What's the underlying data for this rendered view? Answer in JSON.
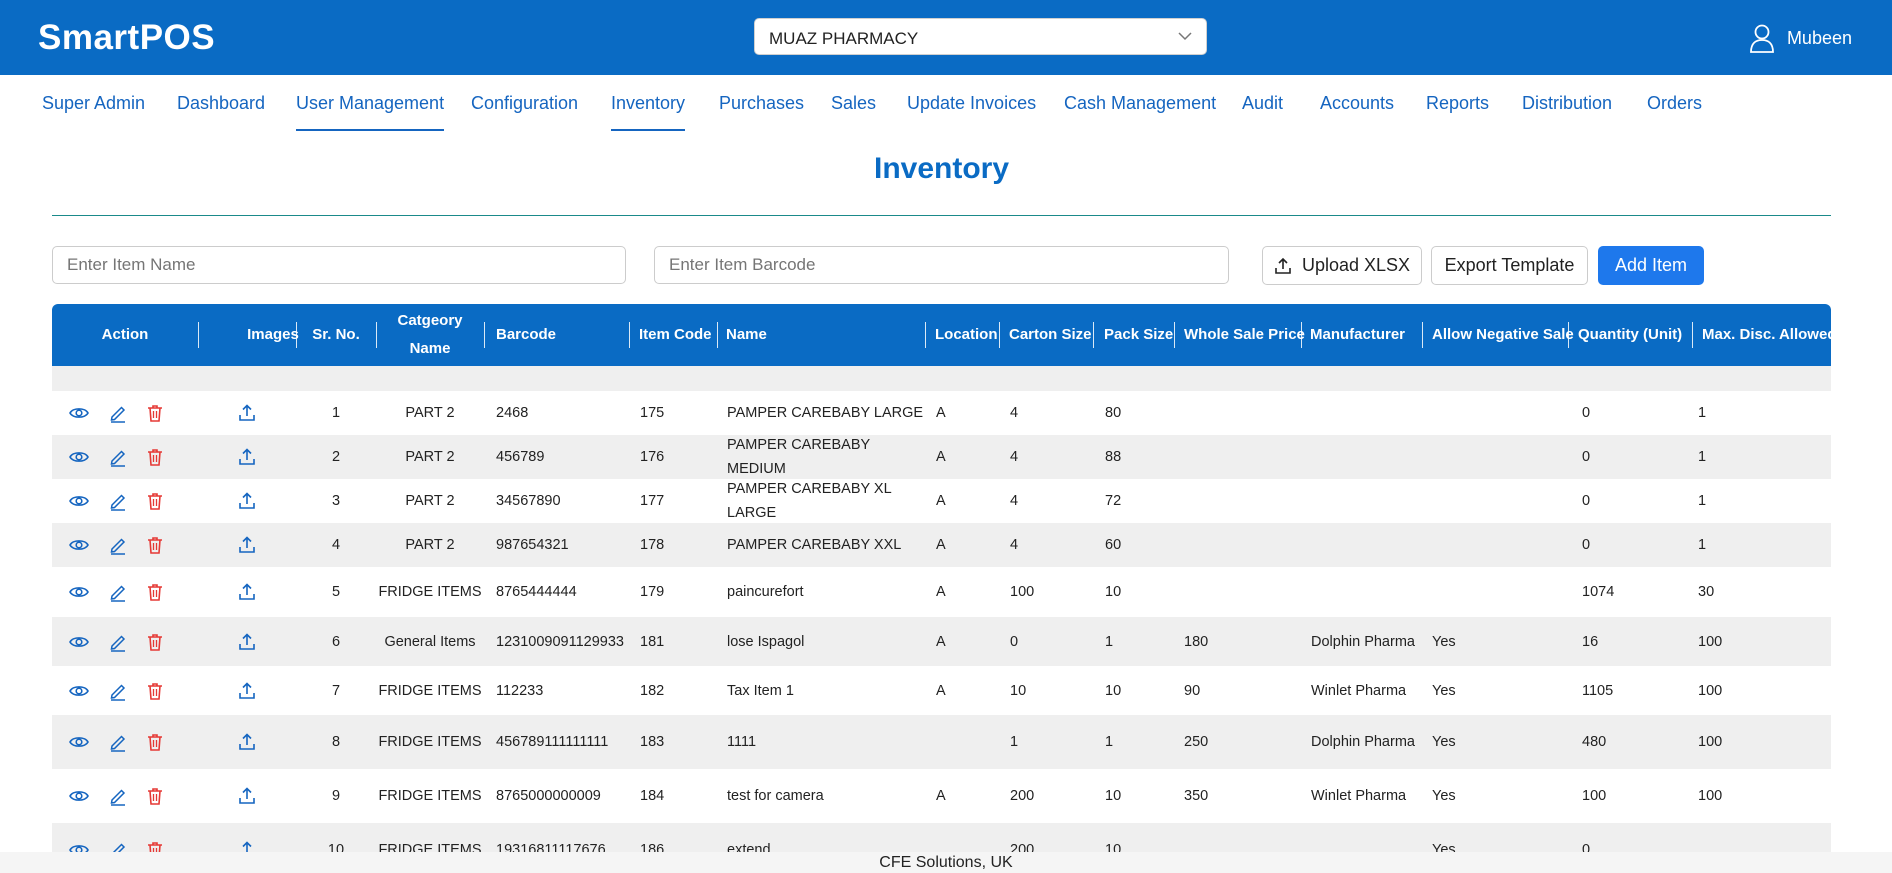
{
  "app": {
    "brand": "SmartPOS",
    "store": "MUAZ PHARMACY",
    "user": "Mubeen"
  },
  "nav": [
    {
      "label": "Super Admin",
      "active": false
    },
    {
      "label": "Dashboard",
      "active": false
    },
    {
      "label": "User Management",
      "active": true
    },
    {
      "label": "Configuration",
      "active": false
    },
    {
      "label": "Inventory",
      "active": true
    },
    {
      "label": "Purchases",
      "active": false
    },
    {
      "label": "Sales",
      "active": false
    },
    {
      "label": "Update Invoices",
      "active": false
    },
    {
      "label": "Cash Management",
      "active": false
    },
    {
      "label": "Audit",
      "active": false
    },
    {
      "label": "Accounts",
      "active": false
    },
    {
      "label": "Reports",
      "active": false
    },
    {
      "label": "Distribution",
      "active": false
    },
    {
      "label": "Orders",
      "active": false
    }
  ],
  "page": {
    "title": "Inventory"
  },
  "filters": {
    "item_name_placeholder": "Enter Item Name",
    "barcode_placeholder": "Enter Item Barcode"
  },
  "buttons": {
    "upload": "Upload XLSX",
    "export": "Export Template",
    "add": "Add Item"
  },
  "table": {
    "headers": {
      "action": "Action",
      "images": "Images",
      "sr": "Sr. No.",
      "category_line1": "Catgeory",
      "category_line2": "Name",
      "barcode": "Barcode",
      "item_code": "Item Code",
      "name": "Name",
      "location": "Location",
      "carton": "Carton Size",
      "pack": "Pack Size",
      "wholesale": "Whole Sale Price",
      "manufacturer": "Manufacturer",
      "allow_neg": "Allow Negative Sale",
      "qty": "Quantity (Unit)",
      "max_disc": "Max. Disc. Allowed"
    },
    "rows": [
      {
        "sr": "1",
        "category": "PART 2",
        "barcode": "2468",
        "code": "175",
        "name": "PAMPER CAREBABY LARGE",
        "location": "A",
        "carton": "4",
        "pack": "80",
        "wholesale": "",
        "manufacturer": "",
        "allow": "",
        "qty": "0",
        "disc": "1"
      },
      {
        "sr": "2",
        "category": "PART 2",
        "barcode": "456789",
        "code": "176",
        "name": "PAMPER CAREBABY MEDIUM",
        "location": "A",
        "carton": "4",
        "pack": "88",
        "wholesale": "",
        "manufacturer": "",
        "allow": "",
        "qty": "0",
        "disc": "1"
      },
      {
        "sr": "3",
        "category": "PART 2",
        "barcode": "34567890",
        "code": "177",
        "name": "PAMPER CAREBABY XL LARGE",
        "location": "A",
        "carton": "4",
        "pack": "72",
        "wholesale": "",
        "manufacturer": "",
        "allow": "",
        "qty": "0",
        "disc": "1"
      },
      {
        "sr": "4",
        "category": "PART 2",
        "barcode": "987654321",
        "code": "178",
        "name": "PAMPER CAREBABY XXL",
        "location": "A",
        "carton": "4",
        "pack": "60",
        "wholesale": "",
        "manufacturer": "",
        "allow": "",
        "qty": "0",
        "disc": "1"
      },
      {
        "sr": "5",
        "category": "FRIDGE ITEMS",
        "barcode": "8765444444",
        "code": "179",
        "name": "paincurefort",
        "location": "A",
        "carton": "100",
        "pack": "10",
        "wholesale": "",
        "manufacturer": "",
        "allow": "",
        "qty": "1074",
        "disc": "30"
      },
      {
        "sr": "6",
        "category": "General Items",
        "barcode": "1231009091129933",
        "code": "181",
        "name": "lose Ispagol",
        "location": "A",
        "carton": "0",
        "pack": "1",
        "wholesale": "180",
        "manufacturer": "Dolphin Pharma",
        "allow": "Yes",
        "qty": "16",
        "disc": "100"
      },
      {
        "sr": "7",
        "category": "FRIDGE ITEMS",
        "barcode": "112233",
        "code": "182",
        "name": "Tax Item 1",
        "location": "A",
        "carton": "10",
        "pack": "10",
        "wholesale": "90",
        "manufacturer": "Winlet Pharma",
        "allow": "Yes",
        "qty": "1105",
        "disc": "100"
      },
      {
        "sr": "8",
        "category": "FRIDGE ITEMS",
        "barcode": "456789111111111",
        "code": "183",
        "name": "1111",
        "location": "",
        "carton": "1",
        "pack": "1",
        "wholesale": "250",
        "manufacturer": "Dolphin Pharma",
        "allow": "Yes",
        "qty": "480",
        "disc": "100"
      },
      {
        "sr": "9",
        "category": "FRIDGE ITEMS",
        "barcode": "8765000000009",
        "code": "184",
        "name": "test for camera",
        "location": "A",
        "carton": "200",
        "pack": "10",
        "wholesale": "350",
        "manufacturer": "Winlet Pharma",
        "allow": "Yes",
        "qty": "100",
        "disc": "100"
      },
      {
        "sr": "10",
        "category": "FRIDGE ITEMS",
        "barcode": "19316811117676",
        "code": "186",
        "name": "extend",
        "location": "",
        "carton": "200",
        "pack": "10",
        "wholesale": "",
        "manufacturer": "",
        "allow": "Yes",
        "qty": "0",
        "disc": ""
      }
    ]
  },
  "footer": "CFE Solutions, UK",
  "colors": {
    "brand_blue": "#0a6bc4",
    "primary_button": "#1e78ec",
    "delete_red": "#e53935",
    "icon_blue": "#1565c0"
  }
}
